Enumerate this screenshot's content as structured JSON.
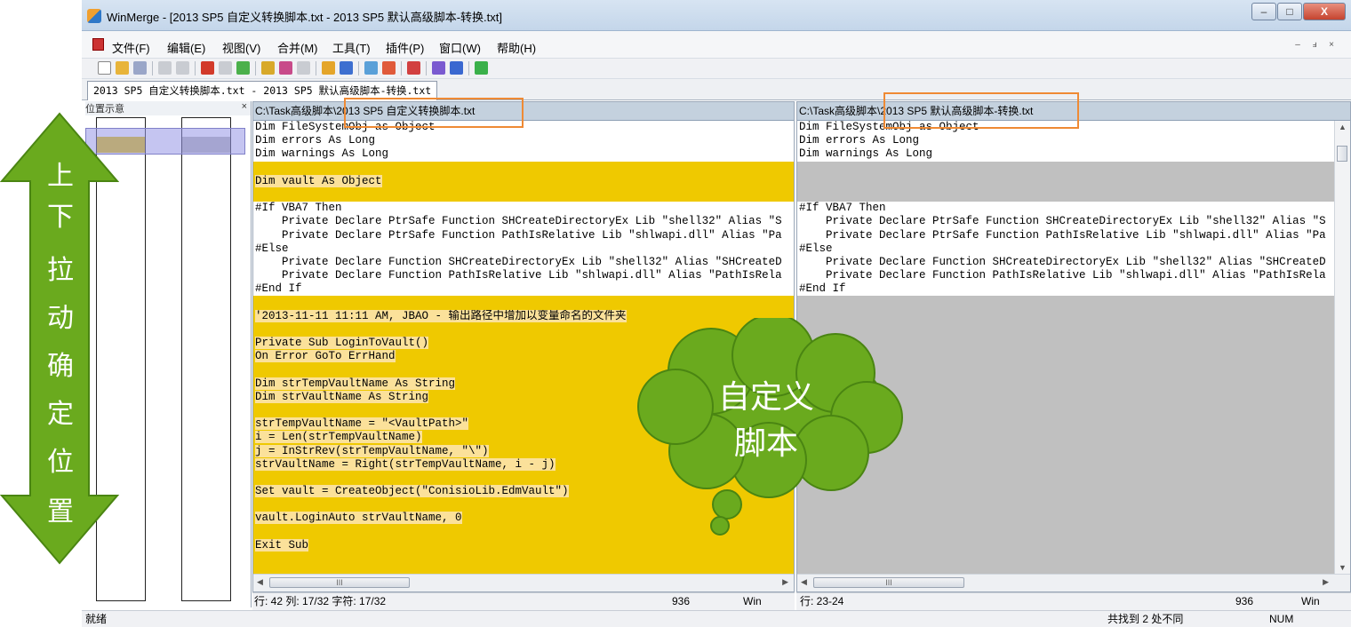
{
  "window": {
    "title": "WinMerge - [2013 SP5 自定义转换脚本.txt - 2013 SP5 默认高级脚本-转换.txt]",
    "buttons": [
      "–",
      "□",
      "X"
    ]
  },
  "menu": {
    "items": [
      "文件(F)",
      "编辑(E)",
      "视图(V)",
      "合并(M)",
      "工具(T)",
      "插件(P)",
      "窗口(W)",
      "帮助(H)"
    ],
    "mdi_buttons": [
      "–",
      "ⅎ",
      "×"
    ]
  },
  "tab": {
    "label": "2013 SP5 自定义转换脚本.txt - 2013 SP5 默认高级脚本-转换.txt"
  },
  "location_pane": {
    "title": "位置示意",
    "close": "×"
  },
  "left_pane": {
    "path": "C:\\Task高级脚本\\2013 SP5 自定义转换脚本.txt",
    "lines": [
      "Dim FileSystemObj as Object",
      "Dim errors As Long",
      "Dim warnings As Long",
      "",
      "Dim vault As Object",
      "",
      "#If VBA7 Then",
      "    Private Declare PtrSafe Function SHCreateDirectoryEx Lib \"shell32\" Alias \"S",
      "    Private Declare PtrSafe Function PathIsRelative Lib \"shlwapi.dll\" Alias \"Pa",
      "#Else",
      "    Private Declare Function SHCreateDirectoryEx Lib \"shell32\" Alias \"SHCreateD",
      "    Private Declare Function PathIsRelative Lib \"shlwapi.dll\" Alias \"PathIsRela",
      "#End If",
      "",
      "'2013-11-11 11:11 AM, JBAO - 输出路径中增加以变量命名的文件夹",
      "",
      "Private Sub LoginToVault()",
      "On Error GoTo ErrHand",
      "",
      "Dim strTempVaultName As String",
      "Dim strVaultName As String",
      "",
      "strTempVaultName = \"<VaultPath>\"",
      "i = Len(strTempVaultName)",
      "j = InStrRev(strTempVaultName, \"\\\")",
      "strVaultName = Right(strTempVaultName, i - j)",
      "",
      "Set vault = CreateObject(\"ConisioLib.EdmVault\")",
      "",
      "vault.LoginAuto strVaultName, 0",
      "",
      "Exit Sub",
      "",
      ""
    ],
    "status": {
      "position": "行: 42  列: 17/32  字符: 17/32",
      "code": "936",
      "eol": "Win"
    },
    "scroll_thumb": "III"
  },
  "right_pane": {
    "path": "C:\\Task高级脚本\\2013 SP5 默认高级脚本-转换.txt",
    "lines": [
      "Dim FileSystemObj as Object",
      "Dim errors As Long",
      "Dim warnings As Long",
      "",
      "",
      "",
      "#If VBA7 Then",
      "    Private Declare PtrSafe Function SHCreateDirectoryEx Lib \"shell32\" Alias \"S",
      "    Private Declare PtrSafe Function PathIsRelative Lib \"shlwapi.dll\" Alias \"Pa",
      "#Else",
      "    Private Declare Function SHCreateDirectoryEx Lib \"shell32\" Alias \"SHCreateD",
      "    Private Declare Function PathIsRelative Lib \"shlwapi.dll\" Alias \"PathIsRela",
      "#End If"
    ],
    "status": {
      "position": "行: 23-24",
      "code": "936",
      "eol": "Win"
    },
    "scroll_thumb": "III"
  },
  "statusbar": {
    "ready": "就绪",
    "diff_count": "共找到 2 处不同",
    "num": "NUM"
  },
  "annotations": {
    "arrow_text": [
      "上",
      "下",
      "拉",
      "动",
      "确",
      "定",
      "位",
      "置"
    ],
    "cloud_text_1": "自定义",
    "cloud_text_2": "脚本"
  },
  "colors": {
    "diff_yellow": "#efc900",
    "diff_gray": "#c0c0c0",
    "annotation_green": "#6aaa1e",
    "annotation_orange": "#ef8a34"
  }
}
